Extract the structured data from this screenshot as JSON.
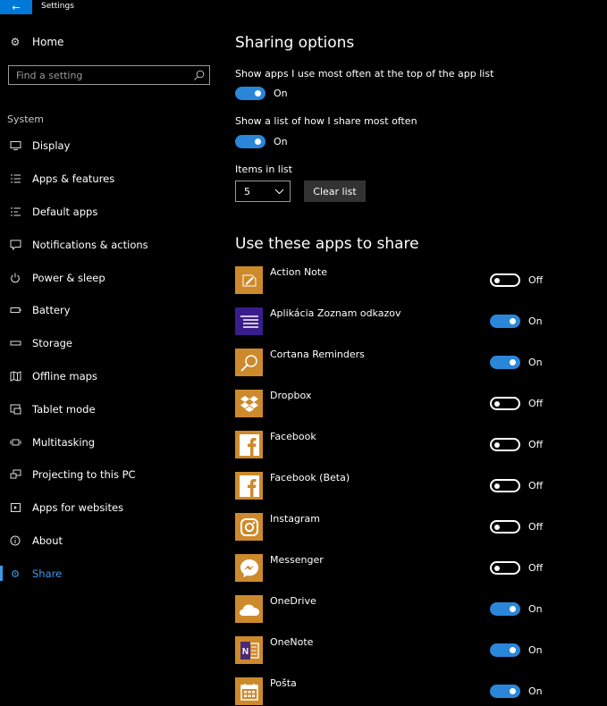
{
  "window": {
    "title": "Settings",
    "back_glyph": "←"
  },
  "sidebar": {
    "home_label": "Home",
    "search_placeholder": "Find a setting",
    "section": "System",
    "items": [
      {
        "label": "Display",
        "icon": "display-icon"
      },
      {
        "label": "Apps & features",
        "icon": "apps-features-icon"
      },
      {
        "label": "Default apps",
        "icon": "default-apps-icon"
      },
      {
        "label": "Notifications & actions",
        "icon": "notifications-icon"
      },
      {
        "label": "Power & sleep",
        "icon": "power-icon"
      },
      {
        "label": "Battery",
        "icon": "battery-icon"
      },
      {
        "label": "Storage",
        "icon": "storage-icon"
      },
      {
        "label": "Offline maps",
        "icon": "map-icon"
      },
      {
        "label": "Tablet mode",
        "icon": "tablet-mode-icon"
      },
      {
        "label": "Multitasking",
        "icon": "multitasking-icon"
      },
      {
        "label": "Projecting to this PC",
        "icon": "projecting-icon"
      },
      {
        "label": "Apps for websites",
        "icon": "apps-websites-icon"
      },
      {
        "label": "About",
        "icon": "info-icon"
      },
      {
        "label": "Share",
        "icon": "gear-icon",
        "active": true
      }
    ]
  },
  "sharing": {
    "heading": "Sharing options",
    "option1": {
      "label": "Show apps I use most often at the top of the app list",
      "state": "On"
    },
    "option2": {
      "label": "Show a list of how I share most often",
      "state": "On"
    },
    "items_label": "Items in list",
    "items_value": "5",
    "clear_label": "Clear list"
  },
  "apps": {
    "heading": "Use these apps to share",
    "list": [
      {
        "name": "Action Note",
        "state": "Off",
        "color": "#cd8a2c"
      },
      {
        "name": "Aplikácia Zoznam odkazov",
        "state": "On",
        "color": "#3a1d8c"
      },
      {
        "name": "Cortana Reminders",
        "state": "On",
        "color": "#cd8a2c"
      },
      {
        "name": "Dropbox",
        "state": "Off",
        "color": "#cd8a2c"
      },
      {
        "name": "Facebook",
        "state": "Off",
        "color": "#cd8a2c"
      },
      {
        "name": "Facebook (Beta)",
        "state": "Off",
        "color": "#cd8a2c"
      },
      {
        "name": "Instagram",
        "state": "Off",
        "color": "#cd8a2c"
      },
      {
        "name": "Messenger",
        "state": "Off",
        "color": "#cd8a2c"
      },
      {
        "name": "OneDrive",
        "state": "On",
        "color": "#cd8a2c"
      },
      {
        "name": "OneNote",
        "state": "On",
        "color": "#cd8a2c"
      },
      {
        "name": "Pošta",
        "state": "On",
        "color": "#cd8a2c"
      }
    ]
  },
  "colors": {
    "accent": "#0078d7",
    "toggle_on": "#2a86d8",
    "app_tile": "#cd8a2c"
  }
}
